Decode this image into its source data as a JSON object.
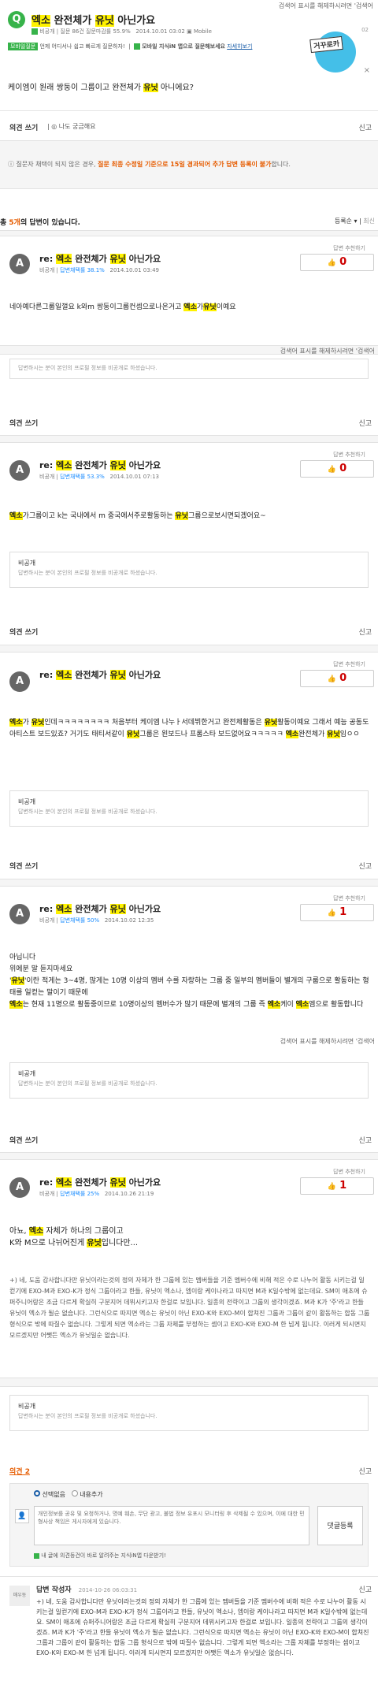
{
  "translate_bar": "검색어 표시를 해제하시려면 '검색어",
  "question": {
    "title_pre": "엑소",
    "title_mid": "완전체가",
    "title_hl2": "유닛",
    "title_post": "아닌가요",
    "author": "비공개",
    "meta": "질문 86건 질문마감률 55.9%",
    "date": "2014.10.01 03:02",
    "device": "Mobile",
    "tag_mobile": "모바일질문",
    "tag_mobile_text": "언제 어디서나 쉽고 빠르게 질문하자!",
    "tag_app": "모바일 지식iN 앱으로 질문해보세요",
    "tag_app_link": "자세히보기",
    "body": "케이엠이 원래 쌍둥이 그룹이고 완전체가 유닛 아니에요?",
    "opinion": "의견 쓰기",
    "curious": "나도 궁금해요",
    "report": "신고",
    "notice_text": "질문자 채택이 되지 않은 경우, 질문 최종 수정일 기준으로 15일 경과되어 추가 답변 등록이 불가합니다.",
    "badge": "거꾸로카",
    "badge_number": "02"
  },
  "answers_header": {
    "count_text": "총 5개의 답변이 있습니다.",
    "sort": "등록순",
    "sort2": "최신"
  },
  "answers": [
    {
      "author": "비공개",
      "rate": "답변채택률 38.1%",
      "date": "2014.10.01 03:49",
      "count": "0",
      "body": "네아예다른그룹일껄요 k와m 쌍둥이그룹컨셉으로나온거고 엑소가유닛이예요"
    },
    {
      "author": "비공개",
      "rate": "답변채택률 53.3%",
      "date": "2014.10.01 07:13",
      "count": "0",
      "body": "엑소가그룹이고 k는 국내에서 m 중국에서주로활동하는 유닛그룹으로보시면되겠어요~"
    },
    {
      "author": "비공개",
      "rate": "답변채택률",
      "date": "2014.10.01",
      "count": "0",
      "body": "엑소가 유닛인데ㅋㅋㅋㅋㅋㅋㅋㅋ 처음부터 케이엠 나누ㅏ서데뷔한거고 완전체활동은 유닛활동이예요 그래서 예능 공동도 아티스트 보드있죠? 거기도 태티서같이 유닛그룹은 왼보드나 프롬스타 보드없어요ㅋㅋㅋㅋㅋ 엑소완전체가 유닛임ㅇㅇ"
    },
    {
      "author": "비공개",
      "rate": "답변채택률 50%",
      "date": "2014.10.02 12:35",
      "count": "1",
      "body": "아닙니다 위에분 말 듣지마세요 '유닛'이란 적게는 3~4명, 많게는 10명 이상의 멤버 수를 자랑하는 그룹 중 일부의 멤버들이 별개의 구룹으로 활동하는 형태를 일컫는 말이기 때문에 엑소는 현재 11명으로 활동중이므로 10명이상의 멤버수가 많기 때문에 별개의 그룹 즉 엑소케이 엑소엠으로 활동합니다"
    },
    {
      "author": "비공개",
      "rate": "답변채택률 25%",
      "date": "2014.10.26 21:19",
      "count": "1",
      "body1": "아뇨, 엑소 자체가 하나의 그룹이고 K와 M으로 나뉘어진게 유닛입니다만...",
      "body2": "+) 네, 도움 감사합니다만 유닛이라는것의 정의 자체가 한 그룹에 있는 멤버들을 기준 멤버수에 비해 적은 수로 나누어 활동 시키는걸 일컫기에 EXO-M과 EXO-K가 정식 그룹이라고 한들, 유닛이 엑소나, 엠이랑 케이나라고 따지면 M과 K일수밖에 없는데요. SM이 애초에 슈퍼주니어랑은 조금 다르게 확실히 구분지어 데뷔시키고자 한걸로 보입니다. 일종의 전략이고 그룹의 생각이겠죠. M과 K가 '주'라고 한들 유닛이 엑소가 될순 없습니다. 그런식으로 따지면 엑소는 유닛이 아닌 EXO-K와 EXO-M이 합쳐진 그룹과 그룹이 같이 활동하는 합동 그룹 형식으로 밖에 따질수 없습니다. 그렇게 되면 엑소라는 그룹 자체를 부정하는 셈이고 EXO-K와 EXO-M 한 넘게 됩니다. 이러게 되시면지 모르겠지만 어쨋든 엑소가 유닛일순 없습니다."
    }
  ],
  "private": {
    "title": "비공개",
    "desc": "답변하시는 분이 본인의 프로필 정보를 비공개로 하셨습니다."
  },
  "comments": {
    "title": "의견 2",
    "opt1": "선택없음",
    "opt2": "내용추가",
    "placeholder": "개인정보를 공유 및 요청하거나, 명예 훼손, 무단 광고, 불법 정보 유포시 모니터링 후 삭제될 수 있으며, 이에 대한 민형사상 책임은 게시자에게 있습니다.",
    "submit": "댓글등록",
    "note": "내 글에 의견등건이 바로 알려주는 지식iN앱 다운받기!",
    "writer": "답변 작성자",
    "writer_label": "매우동",
    "writer_date": "2014-10-26 06:03:31",
    "writer_text": "+) 네, 도움 감사합니다만 유닛이라는것의 정의 자체가 한 그룹에 있는 멤버들을 기준 멤버수에 비해 적은 수로 나누어 활동 시키는걸 일컫기에 EXO-M과 EXO-K가 정식 그룹이라고 한들, 유닛이 엑소나, 엠이랑 케이나라고 따지면 M과 K일수밖에 없는데요. SM이 애초에 슈퍼주니어랑은 조금 다르게 확실히 구분지어 데뷔시키고자 한걸로 보입니다. 일종의 전략이고 그룹의 생각이겠죠. M과 K가 '주'라고 한들 유닛이 엑소가 될순 없습니다. 그런식으로 따지면 엑소는 유닛이 아닌 EXO-K와 EXO-M이 합쳐진 그룹과 그룹이 같이 활동하는 합동 그룹 형식으로 밖에 따질수 없습니다. 그렇게 되면 엑소라는 그룹 자체를 부정하는 셈이고 EXO-K와 EXO-M 한 넘게 됩니다. 이러게 되시면지 모르겠지만 어쨋든 엑소가 유닛일순 없습니다.",
    "report": "신고"
  },
  "common": {
    "opinion": "의견 쓰기",
    "report": "신고",
    "re": "re:",
    "rec_label": "답변 추천하기",
    "thumb": "👍"
  },
  "colors": {
    "green": "#37b34a",
    "highlight": "#fff200",
    "red": "#cc0000"
  }
}
